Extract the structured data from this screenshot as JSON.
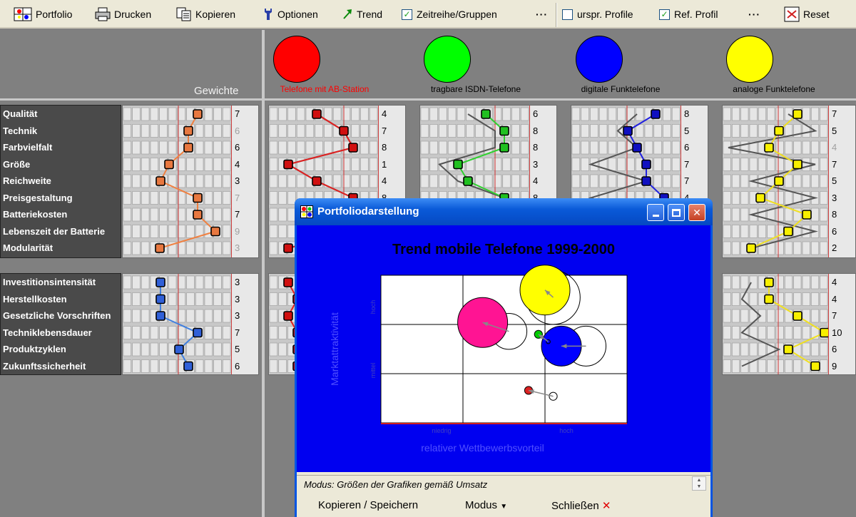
{
  "toolbar": {
    "portfolio": "Portfolio",
    "drucken": "Drucken",
    "kopieren": "Kopieren",
    "optionen": "Optionen",
    "trend": "Trend",
    "zeitreihe": "Zeitreihe/Gruppen",
    "more1": "···",
    "urspr_profile": "urspr. Profile",
    "ref_profil": "Ref. Profil",
    "more2": "···",
    "reset": "Reset"
  },
  "weights_title": "Gewichte",
  "products": [
    {
      "label": "Telefone mit AB-Station",
      "color": "#ff0000",
      "label_color": "#ff0000"
    },
    {
      "label": "tragbare ISDN-Telefone",
      "color": "#00ff00",
      "label_color": "#000000"
    },
    {
      "label": "digitale Funktelefone",
      "color": "#0000ff",
      "label_color": "#000000"
    },
    {
      "label": "analoge Funktelefone",
      "color": "#ffff00",
      "label_color": "#000000"
    }
  ],
  "criteria_top": [
    "Qualität",
    "Technik",
    "Farbvielfalt",
    "Größe",
    "Reichweite",
    "Preisgestaltung",
    "Batteriekosten",
    "Lebenszeit der Batterie",
    "Modularität"
  ],
  "criteria_bottom": [
    "Investitionsintensität",
    "Herstellkosten",
    "Gesetzliche Vorschriften",
    "Techniklebensdauer",
    "Produktzyklen",
    "Zukunftssicherheit"
  ],
  "weights_top": [
    "7",
    "6",
    "6",
    "4",
    "3",
    "7",
    "7",
    "9",
    "3"
  ],
  "weights_top_dim": [
    false,
    true,
    false,
    false,
    false,
    true,
    false,
    true,
    true
  ],
  "weights_bottom": [
    "3",
    "3",
    "3",
    "7",
    "5",
    "6"
  ],
  "prod1_values": [
    "4",
    "7",
    "8",
    "1",
    "4",
    "8"
  ],
  "prod2_values": [
    "6",
    "8",
    "8",
    "3",
    "4",
    "8"
  ],
  "prod3_values": [
    "8",
    "5",
    "6",
    "7",
    "7",
    "4"
  ],
  "prod4_values_top": [
    "7",
    "5",
    "4",
    "7",
    "5",
    "3",
    "8",
    "6",
    "2"
  ],
  "prod4_values_top_dim": [
    false,
    false,
    true,
    false,
    false,
    false,
    false,
    false,
    false
  ],
  "prod4_values_bottom": [
    "4",
    "4",
    "7",
    "10",
    "6",
    "9"
  ],
  "window": {
    "title": "Portfoliodarstellung",
    "status": "Modus: Größen der Grafiken gemäß Umsatz",
    "btn_copy": "Kopieren / Speichern",
    "btn_mode": "Modus",
    "btn_close": "Schließen"
  },
  "chart_data": {
    "type": "scatter",
    "title": "Trend mobile Telefone 1999-2000",
    "xlabel": "relativer Wettbewerbsvorteil",
    "ylabel": "Marktattraktivität",
    "x_ticks": [
      "niedrig",
      "hoch"
    ],
    "y_ticks": [
      "hoch",
      "mittel"
    ],
    "series": [
      {
        "color": "#ff1493",
        "from": [
          0.78,
          0.62
        ],
        "to": [
          0.62,
          0.68
        ],
        "size_from": 0.9,
        "size_to": 1.25
      },
      {
        "color": "#ffff00",
        "from": [
          1.05,
          0.85
        ],
        "to": [
          1.0,
          0.9
        ],
        "size_from": 1.35,
        "size_to": 1.25
      },
      {
        "color": "#0000ff",
        "from": [
          1.25,
          0.52
        ],
        "to": [
          1.1,
          0.52
        ],
        "size_from": 1.0,
        "size_to": 1.0
      },
      {
        "color": "#00cc00",
        "from": [
          1.02,
          0.55
        ],
        "to": [
          0.96,
          0.6
        ],
        "size_from": 0.1,
        "size_to": 0.2
      },
      {
        "color": "#dd2222",
        "from": [
          1.05,
          0.18
        ],
        "to": [
          0.9,
          0.22
        ],
        "size_from": 0.2,
        "size_to": 0.2
      }
    ]
  }
}
